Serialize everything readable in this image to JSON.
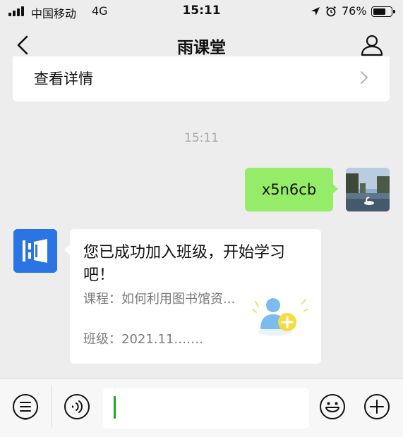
{
  "status_bar": {
    "carrier": "中国移动",
    "network": "4G",
    "time": "15:11",
    "battery_pct": "76%",
    "battery_level": 0.76
  },
  "nav": {
    "title": "雨课堂",
    "back_icon": "chevron-left-icon",
    "profile_icon": "person-icon"
  },
  "previous_card": {
    "label": "查看详情"
  },
  "chat": {
    "timestamp": "15:11",
    "outgoing": {
      "text": "x5n6cb"
    },
    "incoming": {
      "title": "您已成功加入班级，开始学习吧！",
      "course": "课程：如何利用图书馆资...",
      "class": "班级：2021.11.……"
    }
  },
  "input_bar": {
    "menu_icon": "list-menu-icon",
    "voice_icon": "voice-icon",
    "emoji_icon": "emoji-icon",
    "plus_icon": "plus-icon",
    "value": ""
  },
  "colors": {
    "background": "#ededed",
    "outgoing_bubble": "#95ec69",
    "brand_blue": "#2a74e3",
    "caret": "#1aad19"
  }
}
